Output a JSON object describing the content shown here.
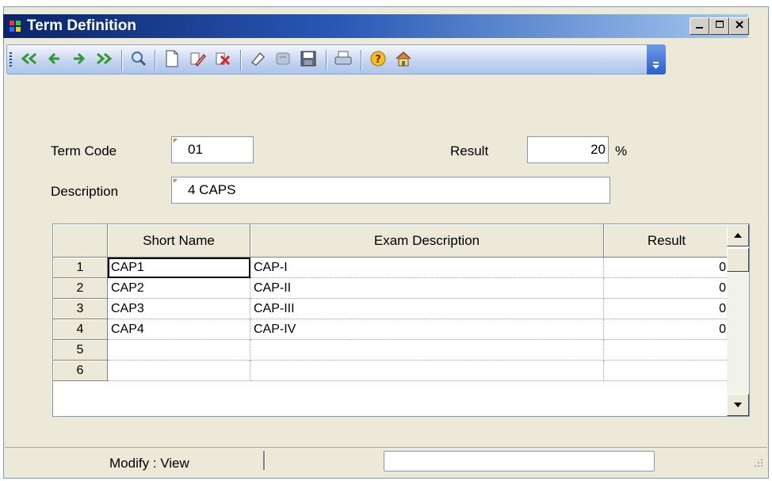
{
  "window": {
    "title": "Term Definition",
    "controls": {
      "minimize": "minimize-icon",
      "maximize": "maximize-icon",
      "close": "close-icon"
    }
  },
  "toolbar": {
    "buttons": [
      {
        "name": "first-record",
        "icon": "double-arrow-left-icon"
      },
      {
        "name": "previous-record",
        "icon": "arrow-left-icon"
      },
      {
        "name": "next-record",
        "icon": "arrow-right-icon"
      },
      {
        "name": "last-record",
        "icon": "double-arrow-right-icon"
      },
      {
        "name": "search",
        "icon": "magnifier-icon"
      },
      {
        "name": "new",
        "icon": "new-document-icon"
      },
      {
        "name": "edit",
        "icon": "pencil-icon"
      },
      {
        "name": "delete",
        "icon": "delete-icon"
      },
      {
        "name": "clear",
        "icon": "eraser-icon"
      },
      {
        "name": "undo",
        "icon": "undo-icon"
      },
      {
        "name": "save",
        "icon": "floppy-icon"
      },
      {
        "name": "print",
        "icon": "printer-icon"
      },
      {
        "name": "help",
        "icon": "help-icon"
      },
      {
        "name": "home",
        "icon": "home-icon"
      }
    ]
  },
  "form": {
    "term_code_label": "Term Code",
    "term_code_value": "01",
    "result_label": "Result",
    "result_value": "20",
    "result_unit": "%",
    "description_label": "Description",
    "description_value": "4 CAPS"
  },
  "grid": {
    "columns": [
      "Short Name",
      "Exam Description",
      "Result"
    ],
    "rows": [
      {
        "num": "1",
        "short": "CAP1",
        "desc": "CAP-I",
        "result": "0"
      },
      {
        "num": "2",
        "short": "CAP2",
        "desc": "CAP-II",
        "result": "0"
      },
      {
        "num": "3",
        "short": "CAP3",
        "desc": "CAP-III",
        "result": "0"
      },
      {
        "num": "4",
        "short": "CAP4",
        "desc": "CAP-IV",
        "result": "0"
      },
      {
        "num": "5",
        "short": "",
        "desc": "",
        "result": ""
      },
      {
        "num": "6",
        "short": "",
        "desc": "",
        "result": ""
      }
    ]
  },
  "status": {
    "mode_text": "Modify : View"
  },
  "colors": {
    "title_gradient_start": "#0a246a",
    "title_gradient_end": "#a6caf0",
    "required_marker": "#e8742a"
  }
}
